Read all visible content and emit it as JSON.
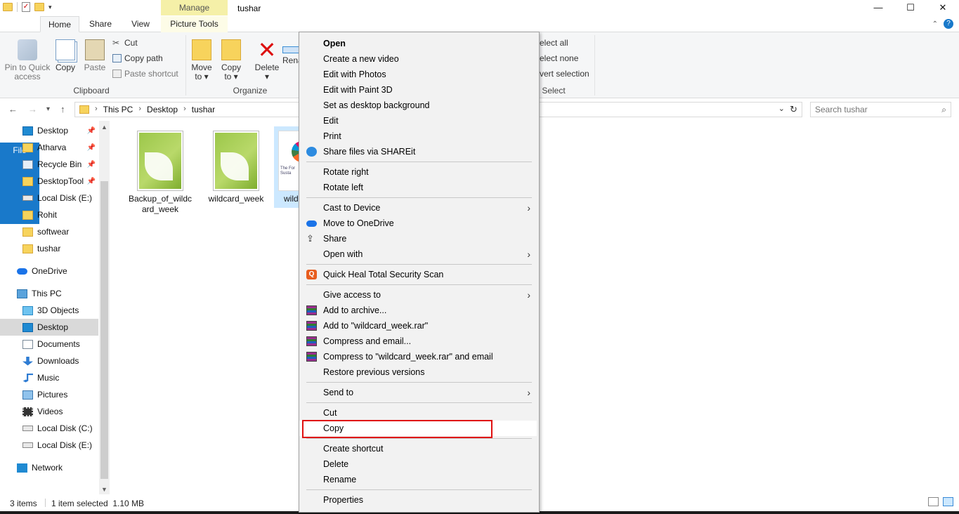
{
  "window": {
    "title": "tushar",
    "manage_tab": "Manage",
    "controls": [
      "—",
      "☐",
      "✕"
    ]
  },
  "tabs": {
    "file": "File",
    "home": "Home",
    "share": "Share",
    "view": "View",
    "picture_tools": "Picture Tools"
  },
  "ribbon": {
    "pin_label_1": "Pin to Quick",
    "pin_label_2": "access",
    "copy": "Copy",
    "paste": "Paste",
    "cut": "Cut",
    "copy_path": "Copy path",
    "paste_shortcut": "Paste shortcut",
    "clipboard_group": "Clipboard",
    "move_to_1": "Move",
    "move_to_2": "to",
    "copy_to_1": "Copy",
    "copy_to_2": "to",
    "delete": "Delete",
    "rename": "Rena",
    "organize_group": "Organize",
    "select_all": "elect all",
    "select_none": "elect none",
    "invert_selection": "vert selection",
    "select_group": "Select"
  },
  "address": {
    "crumbs": [
      "This PC",
      "Desktop",
      "tushar"
    ],
    "search_placeholder": "Search tushar"
  },
  "nav": {
    "quick_access": [
      {
        "label": "Desktop",
        "pinned": true
      },
      {
        "label": "Atharva",
        "pinned": true
      },
      {
        "label": "Recycle Bin",
        "pinned": true
      },
      {
        "label": "DesktopTool",
        "pinned": true
      },
      {
        "label": "Local Disk (E:)",
        "pinned": false
      },
      {
        "label": "Rohit",
        "pinned": false
      },
      {
        "label": "softwear",
        "pinned": false
      },
      {
        "label": "tushar",
        "pinned": false
      }
    ],
    "onedrive": "OneDrive",
    "this_pc": "This PC",
    "this_pc_items": [
      "3D Objects",
      "Desktop",
      "Documents",
      "Downloads",
      "Music",
      "Pictures",
      "Videos",
      "Local Disk (C:)",
      "Local Disk (E:)"
    ],
    "network": "Network",
    "selected": "Desktop"
  },
  "files": [
    {
      "name": "Backup_of_wildcard_week",
      "icon": "coreldraw-icon",
      "selected": false
    },
    {
      "name": "wildcard_week",
      "icon": "coreldraw-icon",
      "selected": false
    },
    {
      "name": "wild",
      "icon": "image-thumbnail",
      "selected": true
    }
  ],
  "thumb_text": "The For Susta",
  "status": {
    "count": "3 items",
    "selection": "1 item selected  1.10 MB"
  },
  "context_menu": {
    "items": [
      {
        "label": "Open",
        "bold": true
      },
      {
        "label": "Create a new video"
      },
      {
        "label": "Edit with Photos"
      },
      {
        "label": "Edit with Paint 3D"
      },
      {
        "label": "Set as desktop background"
      },
      {
        "label": "Edit"
      },
      {
        "label": "Print"
      },
      {
        "label": "Share files via SHAREit",
        "icon": "shareit-icon"
      },
      {
        "label": "Rotate right"
      },
      {
        "label": "Rotate left"
      },
      {
        "label": "Cast to Device",
        "submenu": true
      },
      {
        "label": "Move to OneDrive",
        "icon": "onedrive-icon"
      },
      {
        "label": "Share",
        "icon": "share-icon"
      },
      {
        "label": "Open with",
        "submenu": true
      },
      {
        "label": "Quick Heal Total Security Scan",
        "icon": "quickheal-icon"
      },
      {
        "label": "Give access to",
        "submenu": true
      },
      {
        "label": "Add to archive...",
        "icon": "winrar-icon"
      },
      {
        "label": "Add to \"wildcard_week.rar\"",
        "icon": "winrar-icon"
      },
      {
        "label": "Compress and email...",
        "icon": "winrar-icon"
      },
      {
        "label": "Compress to \"wildcard_week.rar\" and email",
        "icon": "winrar-icon"
      },
      {
        "label": "Restore previous versions"
      },
      {
        "label": "Send to",
        "submenu": true
      },
      {
        "label": "Cut"
      },
      {
        "label": "Copy",
        "highlighted": true
      },
      {
        "label": "Create shortcut"
      },
      {
        "label": "Delete"
      },
      {
        "label": "Rename"
      },
      {
        "label": "Properties"
      }
    ]
  },
  "colors": {
    "file_tab": "#1979ca",
    "selection": "#cce8ff",
    "highlight_box": "#e01010",
    "manage_tab": "#f5f0a8"
  }
}
